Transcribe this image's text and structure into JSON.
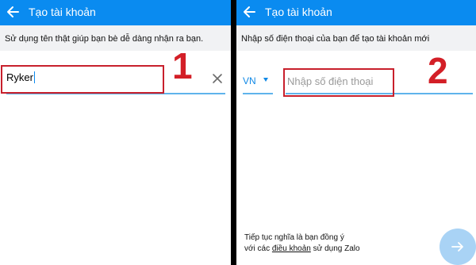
{
  "left": {
    "appbar": {
      "title": "Tạo tài khoản",
      "back_icon": "arrow-left-icon"
    },
    "hint": "Sử dụng tên thật giúp bạn bè dễ dàng nhận ra bạn.",
    "name_field": {
      "value": "Ryker",
      "clear_icon": "close-icon"
    },
    "step_number": "1"
  },
  "right": {
    "appbar": {
      "title": "Tạo tài khoản",
      "back_icon": "arrow-left-icon"
    },
    "hint": "Nhập số điện thoại của bạn để tạo tài khoản mới",
    "country_code": "VN",
    "phone_field": {
      "placeholder": "Nhập số điện thoại",
      "value": ""
    },
    "step_number": "2",
    "terms": {
      "line1": "Tiếp tục nghĩa là bạn đồng ý",
      "line2_prefix": "với các ",
      "link": "điều khoản",
      "line2_suffix": " sử dụng Zalo"
    },
    "next_icon": "arrow-right-icon"
  },
  "colors": {
    "appbar": "#0a8bf0",
    "accent": "#1189e6",
    "highlight_box": "#c8202c",
    "step_number": "#d31f27",
    "next_button_disabled": "#a9d3f5"
  }
}
